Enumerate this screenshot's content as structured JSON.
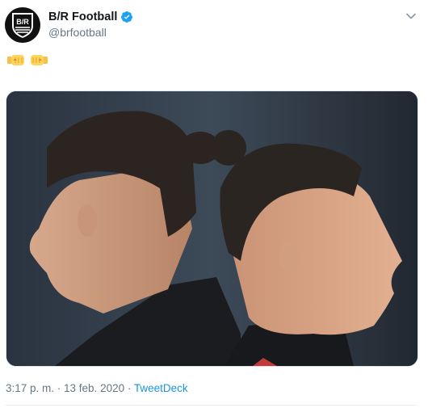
{
  "tweet": {
    "author": {
      "display_name": "B/R Football",
      "handle": "@brfootball",
      "verified": true,
      "avatar_icon": "br-logo-icon"
    },
    "menu_icon": "chevron-down-icon",
    "text_emojis": [
      "fist-bump-left-emoji",
      "fist-bump-right-emoji"
    ],
    "media": {
      "type": "photo",
      "icon": "photo-two-footballers-back-to-back"
    },
    "timestamp": "3:17 p. m. · 13 feb. 2020",
    "separator": " · ",
    "source": "TweetDeck"
  },
  "colors": {
    "link": "#1b95e0",
    "verified_badge": "#1da1f2",
    "secondary_text": "#657786"
  }
}
